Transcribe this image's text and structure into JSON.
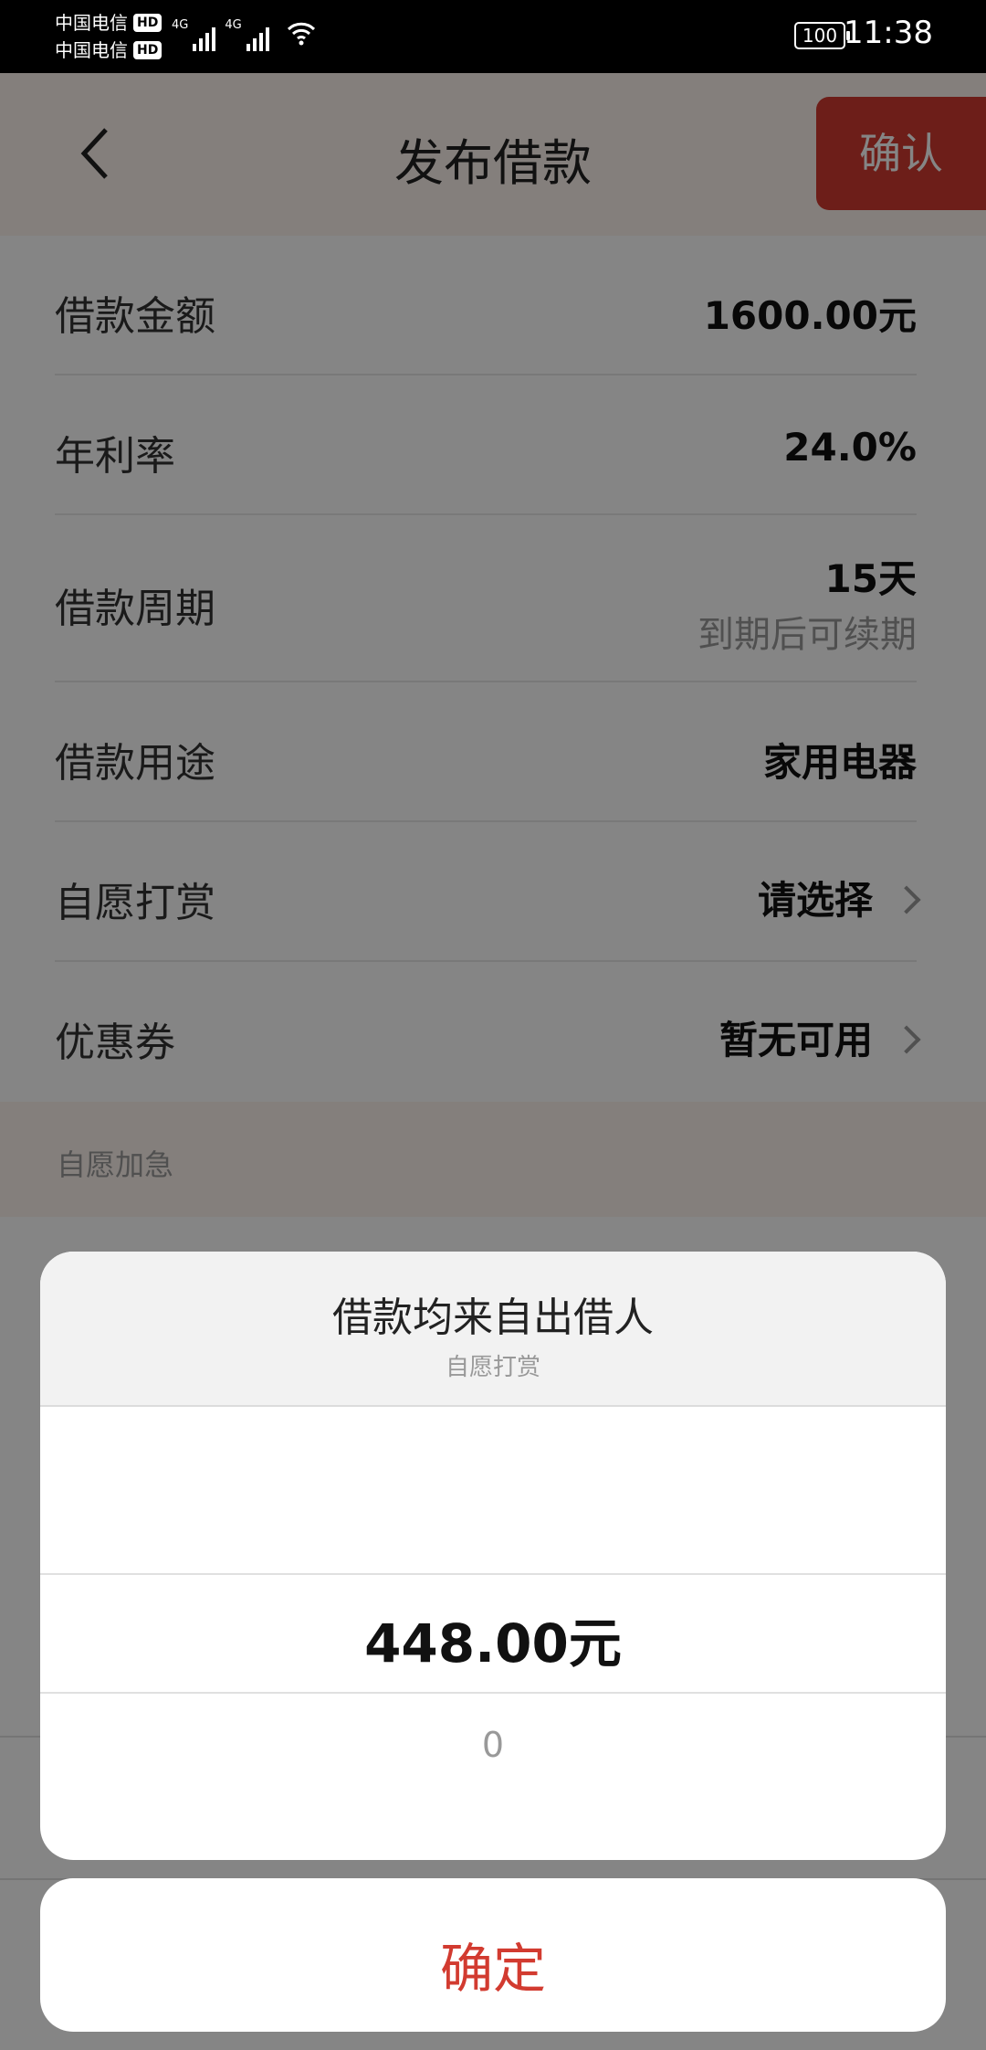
{
  "status_bar": {
    "carrier1": "中国电信",
    "carrier2": "中国电信",
    "hd": "HD",
    "net1": "4G",
    "net2": "4G",
    "battery": "100",
    "time": "11:38"
  },
  "header": {
    "title": "发布借款",
    "confirm_label": "确认"
  },
  "form": {
    "rows": [
      {
        "label": "借款金额",
        "value": "1600.00元"
      },
      {
        "label": "年利率",
        "value": "24.0%"
      },
      {
        "label": "借款周期",
        "value": "15天",
        "sub": "到期后可续期"
      },
      {
        "label": "借款用途",
        "value": "家用电器"
      },
      {
        "label": "自愿打赏",
        "value": "请选择"
      },
      {
        "label": "优惠券",
        "value": "暂无可用"
      }
    ]
  },
  "section": {
    "title": "自愿加急"
  },
  "picker": {
    "title": "借款均来自出借人",
    "subtitle": "自愿打赏",
    "selected": "448.00元",
    "next": "0"
  },
  "footer": {
    "ok_label": "确定"
  },
  "colors": {
    "accent": "#d23b30",
    "header_bg": "#fef3ee"
  }
}
